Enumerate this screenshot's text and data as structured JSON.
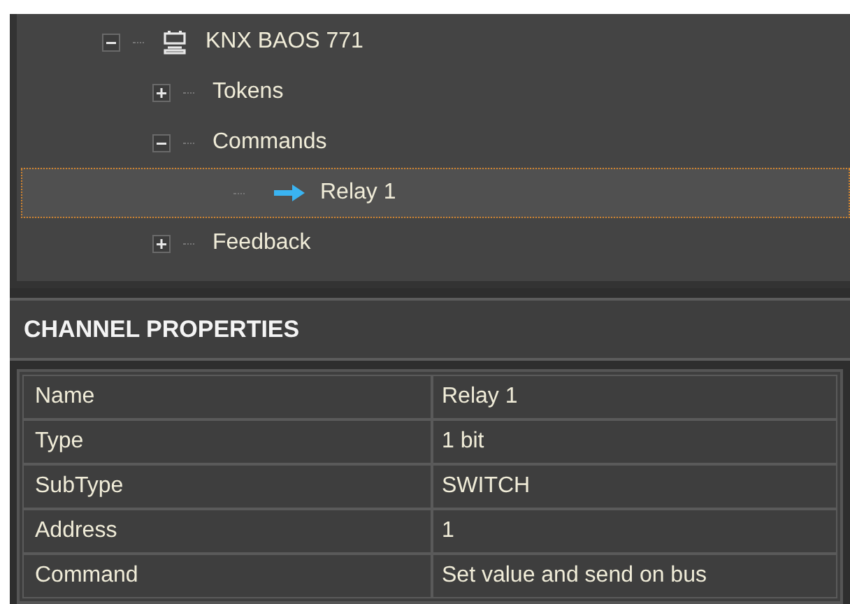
{
  "tree": [
    {
      "label": "KNX BAOS 771",
      "kind": "device",
      "expanded": true,
      "selected": false,
      "children": [
        {
          "label": "Tokens",
          "kind": "folder",
          "expanded": false,
          "selected": false
        },
        {
          "label": "Commands",
          "kind": "folder",
          "expanded": true,
          "selected": false,
          "children": [
            {
              "label": "Relay 1",
              "kind": "command",
              "selected": true
            }
          ]
        },
        {
          "label": "Feedback",
          "kind": "folder",
          "expanded": false,
          "selected": false
        }
      ]
    }
  ],
  "properties": {
    "title": "CHANNEL PROPERTIES",
    "rows": [
      {
        "name": "Name",
        "value": "Relay 1"
      },
      {
        "name": "Type",
        "value": "1 bit"
      },
      {
        "name": "SubType",
        "value": "SWITCH"
      },
      {
        "name": "Address",
        "value": "1"
      },
      {
        "name": "Command",
        "value": "Set value and send on bus"
      }
    ]
  }
}
